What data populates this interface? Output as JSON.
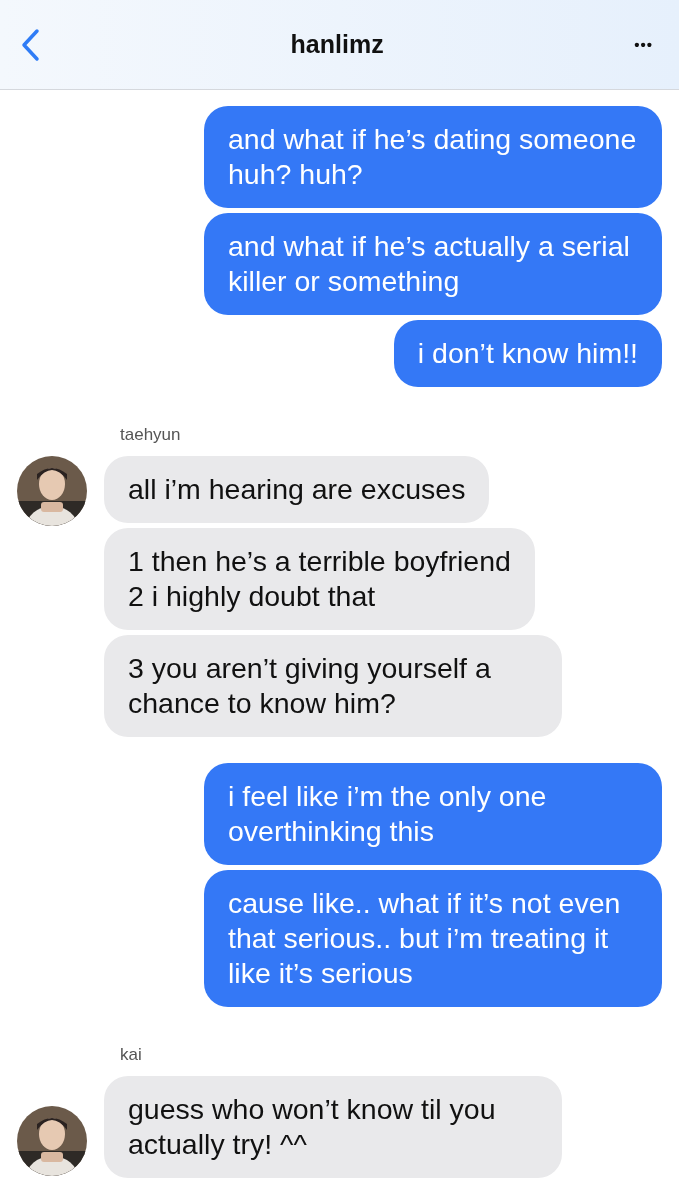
{
  "header": {
    "title": "hanlimz",
    "more": "•••"
  },
  "groups": [
    {
      "kind": "outgoing",
      "bubbles": [
        "and what if he’s dating someone huh? huh?",
        "and what if he’s actually a serial killer or something",
        "i don’t know him!!"
      ]
    },
    {
      "kind": "incoming",
      "sender": "taehyun",
      "bubbles": [
        "all i’m hearing are excuses",
        "1 then he’s a terrible boyfriend\n2 i highly doubt that",
        "3 you aren’t giving yourself a chance to know him?"
      ]
    },
    {
      "kind": "outgoing",
      "bubbles": [
        "i feel like i’m the only one overthinking this",
        "cause like.. what if it’s not even that serious.. but i’m treating it like it’s serious"
      ]
    },
    {
      "kind": "incoming",
      "sender": "kai",
      "bubbles": [
        "guess who won’t know til you actually try! ^^"
      ]
    }
  ]
}
